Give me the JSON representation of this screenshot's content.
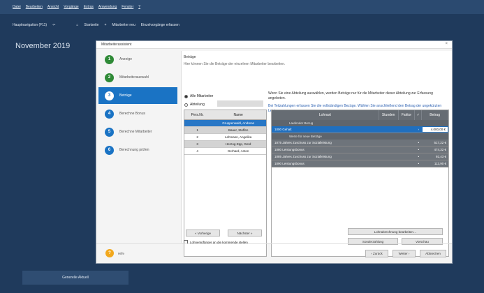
{
  "menubar": [
    "Datei",
    "Bearbeiten",
    "Ansicht",
    "Vorgänge",
    "Extras",
    "Anwendung",
    "Fenster",
    "?"
  ],
  "toolbar": {
    "nav": "Hauptnavigation (F11)",
    "start": "Startseite",
    "new": "Mitarbeiter neu",
    "hint": "Einzelvorgänge erfassen"
  },
  "month": "November 2019",
  "bottom_button": "Generelle Aktuell",
  "dialog": {
    "title": "Mitarbeiterassistent",
    "close": "×",
    "steps": [
      {
        "num": "1",
        "label": "Anzeige",
        "state": "done"
      },
      {
        "num": "2",
        "label": "Mitarbeiterauswahl",
        "state": "done"
      },
      {
        "num": "3",
        "label": "Beträge",
        "state": "current"
      },
      {
        "num": "4",
        "label": "Berechne Bonus",
        "state": "todo"
      },
      {
        "num": "5",
        "label": "Berechne Mitarbeiter",
        "state": "todo"
      },
      {
        "num": "6",
        "label": "Berechnung prüfen",
        "state": "todo"
      }
    ],
    "header": "Beträge",
    "subheader": "Hier können Sie die Beträge der einzelnen Mitarbeiter bearbeiten.",
    "radio_all": "Alle Mitarbeiter",
    "radio_dept": "Abteilung",
    "info_text": "Wenn Sie eine Abteilung auswählen, werden Beträge nur für die Mitarbeiter dieser Abteilung zur Erfassung angeboten.",
    "info_blue": "Bei Teilzahlungen erfassen Sie die vollständigen Bezüge. Wählen Sie anschließend den Betrag der ungekürzten Leistung aus.",
    "emp_headers": [
      "Pers.Nr.",
      "Name"
    ],
    "employees": [
      {
        "nr": "",
        "name": "Gruppenwahl, Andreas",
        "state": "sel"
      },
      {
        "nr": "1",
        "name": "Bauer, Steffen",
        "state": "grey"
      },
      {
        "nr": "2",
        "name": "Lehmann, Angelika",
        "state": "normal"
      },
      {
        "nr": "3",
        "name": "Herzog-Epp, Gerd",
        "state": "grey"
      },
      {
        "nr": "4",
        "name": "Gerhard, Anton",
        "state": "normal"
      }
    ],
    "lohn_headers": [
      "Lohnart",
      "Stunden",
      "Faktor",
      "✓",
      "Betrag"
    ],
    "group1": "Laufender Bezug",
    "lohn_selected": {
      "name": "1000 Gehalt",
      "mark": "›",
      "value": "4.000,00 €"
    },
    "group2": "Werte für neue Beträge",
    "lohn_rows": [
      {
        "name": "1075 Jahres Zuschuss zur Sozialleistung",
        "mark": "•",
        "value": "517,22 €"
      },
      {
        "name": "1080 Leistungsbonus",
        "mark": "•",
        "value": "474,32 €"
      },
      {
        "name": "1085 Jahres Zuschuss zur Sozialleistung",
        "mark": "•",
        "value": "92,43 €"
      },
      {
        "name": "1090 Leistungsbonus",
        "mark": "•",
        "value": "113,90 €"
      }
    ],
    "btn_prev": "« Vorherige",
    "btn_next": "Nächster »",
    "btn_edit_lohn": "Lohnabrechnung bearbeiten…",
    "btn_export": "Sonderzahlung",
    "btn_preview": "Vorschau",
    "checkbox_label": "Lohnempfänger an die kommende stellen",
    "help_label": "Hilfe",
    "btn_back": "‹ Zurück",
    "btn_forward": "Weiter ›",
    "btn_cancel": "Abbrechen"
  }
}
